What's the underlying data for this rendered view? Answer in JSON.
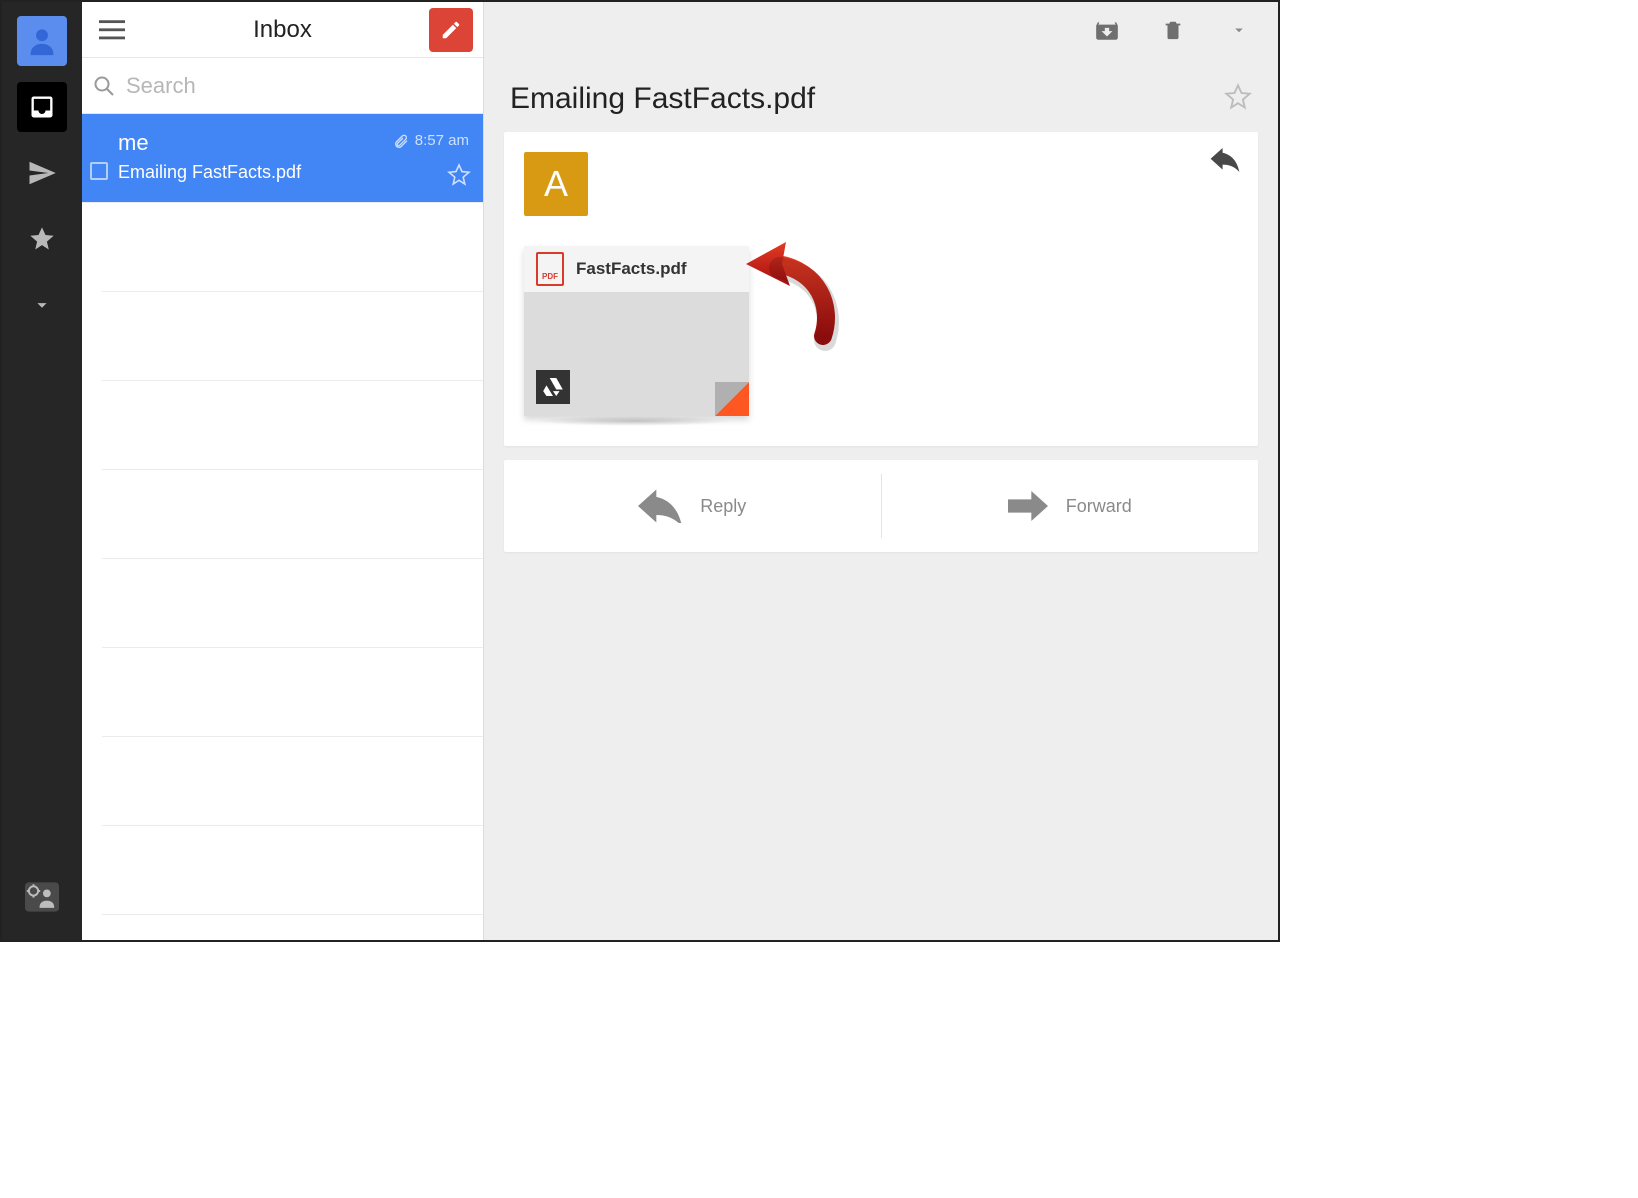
{
  "rail": {
    "items": [
      "profile",
      "inbox",
      "sent",
      "starred",
      "more"
    ],
    "settings_icon": "settings-account-icon"
  },
  "list": {
    "title": "Inbox",
    "search_placeholder": "Search",
    "compose_icon": "pencil-icon",
    "messages": [
      {
        "sender": "me",
        "subject": "Emailing FastFacts.pdf",
        "time": "8:57 am",
        "has_attachment": true,
        "selected": true,
        "starred": false
      }
    ]
  },
  "detail": {
    "subject": "Emailing FastFacts.pdf",
    "sender_initial": "A",
    "attachment": {
      "name": "FastFacts.pdf",
      "type_label": "PDF"
    },
    "actions": {
      "reply_label": "Reply",
      "forward_label": "Forward"
    },
    "toolbar": {
      "archive_icon": "archive-icon",
      "delete_icon": "trash-icon",
      "more_icon": "caret-down-icon"
    }
  }
}
